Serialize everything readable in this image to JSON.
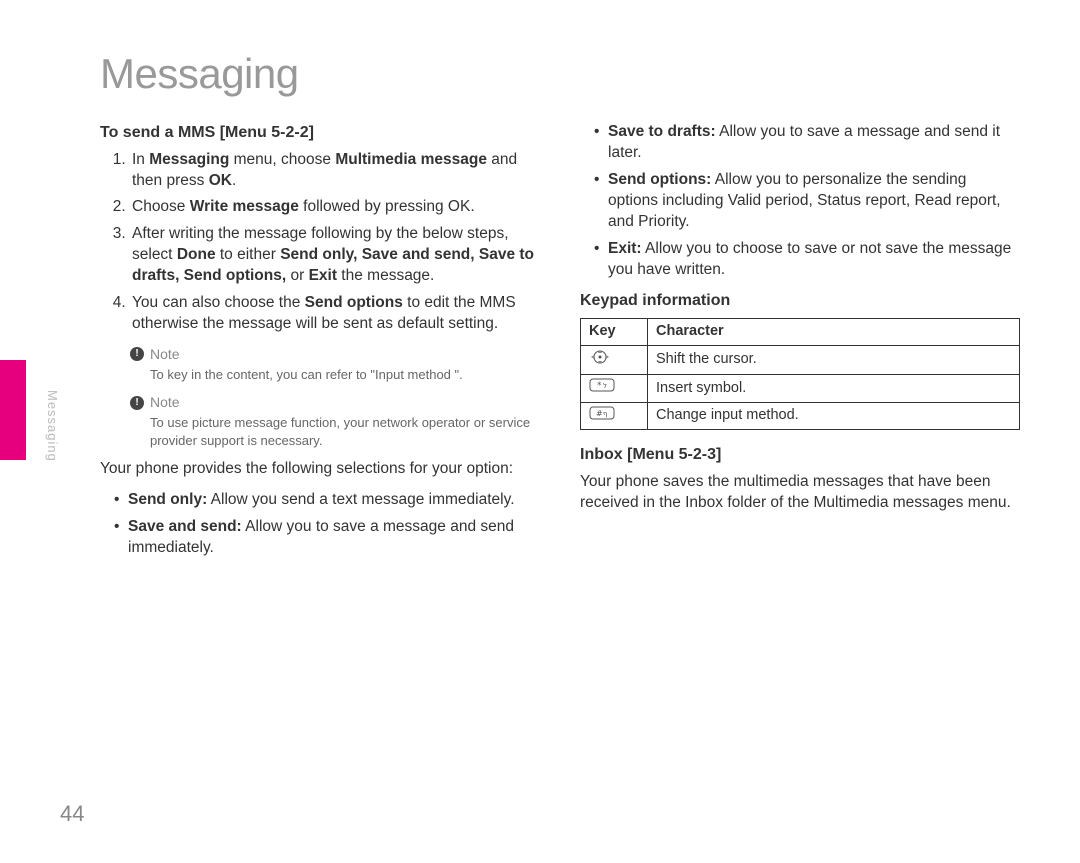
{
  "page": {
    "title": "Messaging",
    "sideLabel": "Messaging",
    "pageNumber": "44"
  },
  "left": {
    "heading": "To send a MMS [Menu 5-2-2]",
    "steps": {
      "s1": {
        "prefix": "In ",
        "b1": "Messaging",
        "mid1": " menu, choose ",
        "b2": "Multimedia message",
        "mid2": " and then press ",
        "b3": "OK",
        "suffix": "."
      },
      "s2": {
        "prefix": "Choose ",
        "b1": "Write message",
        "suffix": " followed by pressing OK."
      },
      "s3": {
        "prefix": "After writing the message following by the below steps, select ",
        "b1": "Done",
        "mid1": " to either ",
        "b2": "Send only, Save and send, Save to drafts, Send options,",
        "mid2": " or ",
        "b3": "Exit",
        "suffix": " the message."
      },
      "s4": {
        "prefix": "You can also choose the ",
        "b1": "Send options",
        "suffix": " to edit the MMS otherwise the message will be sent as default setting."
      }
    },
    "note1": {
      "label": "Note",
      "body": "To key in the content, you can refer to \"Input method \"."
    },
    "note2": {
      "label": "Note",
      "body": "To use picture message function, your network operator or service provider support is necessary."
    },
    "selectionsIntro": "Your phone provides the following selections for your option:",
    "bullets": {
      "b1": {
        "label": "Send only:",
        "text": " Allow you send a text message immediately."
      },
      "b2": {
        "label": "Save and send:",
        "text": " Allow you to save a message and send immediately."
      }
    }
  },
  "right": {
    "bullets": {
      "b1": {
        "label": "Save to drafts:",
        "text": " Allow you to save a message and send it later."
      },
      "b2": {
        "label": "Send options:",
        "text": " Allow you to personalize the sending options including Valid period, Status report, Read report, and Priority."
      },
      "b3": {
        "label": "Exit:",
        "text": " Allow you to choose to save or not save the message you have written."
      }
    },
    "keypadHeading": "Keypad information",
    "table": {
      "hKey": "Key",
      "hChar": "Character",
      "rows": {
        "r1": {
          "glyph": "nav",
          "text": "Shift the cursor."
        },
        "r2": {
          "glyph": "star",
          "text": "Insert symbol."
        },
        "r3": {
          "glyph": "hash",
          "text": "Change input method."
        }
      }
    },
    "inboxHeading": "Inbox [Menu 5-2-3]",
    "inboxBody": "Your phone saves the multimedia messages that have been received in the Inbox folder of the Multimedia messages menu."
  }
}
